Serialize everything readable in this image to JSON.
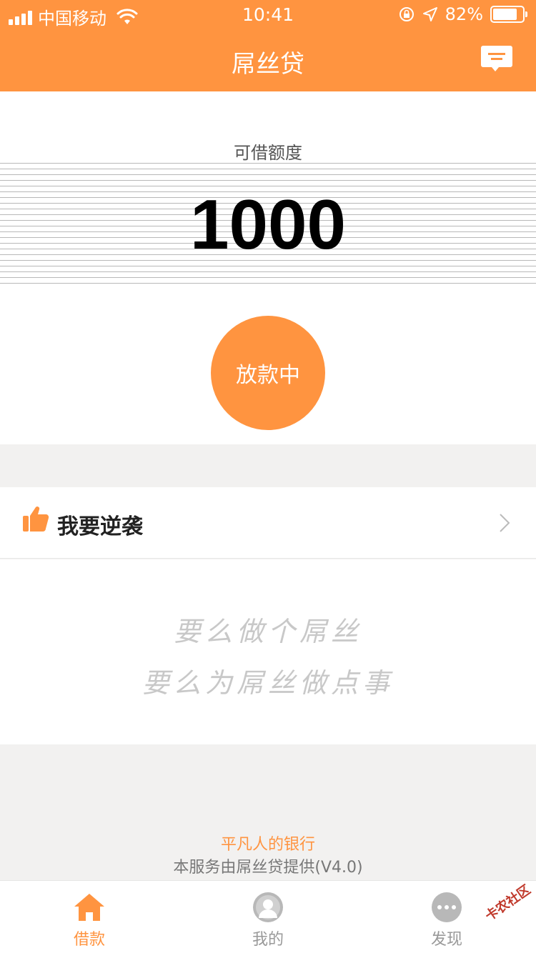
{
  "status_bar": {
    "carrier": "中国移动",
    "time": "10:41",
    "battery_text": "82%",
    "battery_level": 0.82
  },
  "header": {
    "title": "屌丝贷",
    "message_icon": "message-icon"
  },
  "main": {
    "limit_label": "可借额度",
    "amount": "1000",
    "action_button": "放款中"
  },
  "row": {
    "icon": "thumbs-up-icon",
    "label": "我要逆袭"
  },
  "slogan": {
    "line1": "要么做个屌丝",
    "line2": "要么为屌丝做点事"
  },
  "footer": {
    "tagline": "平凡人的银行",
    "provider": "本服务由屌丝贷提供(V4.0)"
  },
  "tabs": [
    {
      "label": "借款",
      "icon": "home-icon",
      "active": true
    },
    {
      "label": "我的",
      "icon": "user-icon",
      "active": false
    },
    {
      "label": "发现",
      "icon": "more-icon",
      "active": false
    }
  ],
  "watermark": "卡农社区",
  "colors": {
    "brand": "#ff9440",
    "background": "#f2f1f0"
  }
}
